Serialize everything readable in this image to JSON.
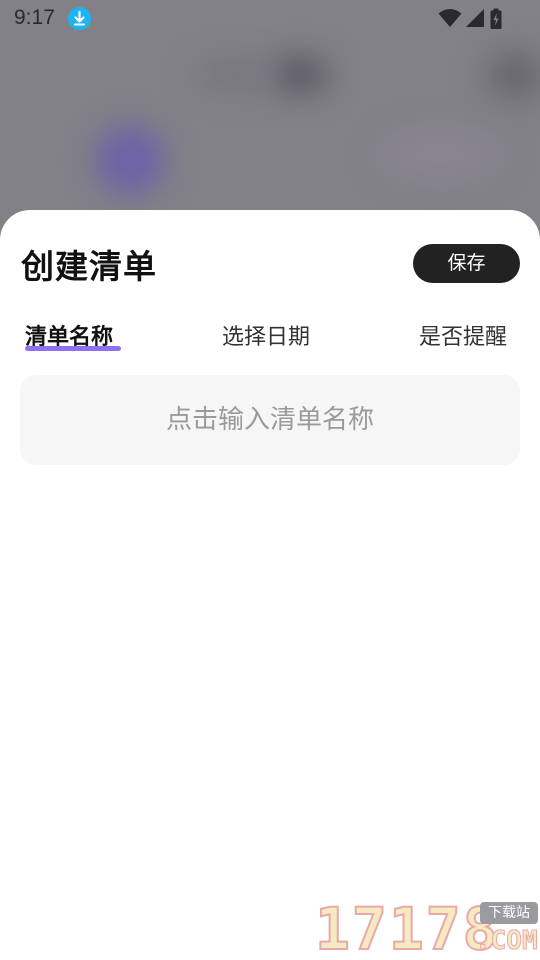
{
  "status_bar": {
    "time": "9:17",
    "icons": [
      "download-icon",
      "wifi-icon",
      "signal-icon",
      "battery-icon"
    ]
  },
  "sheet": {
    "title": "创建清单",
    "save_label": "保存",
    "tabs": [
      {
        "label": "清单名称",
        "active": true
      },
      {
        "label": "选择日期",
        "active": false
      },
      {
        "label": "是否提醒",
        "active": false
      }
    ],
    "name_input": {
      "value": "",
      "placeholder": "点击输入清单名称"
    }
  },
  "watermark": {
    "digits": "17178",
    "badge": "下载站",
    "suffix": ".COM"
  },
  "colors": {
    "accent": "#8d72f0",
    "button_bg": "#222222",
    "input_bg": "#f6f6f6",
    "status_download": "#1ab5f5"
  }
}
